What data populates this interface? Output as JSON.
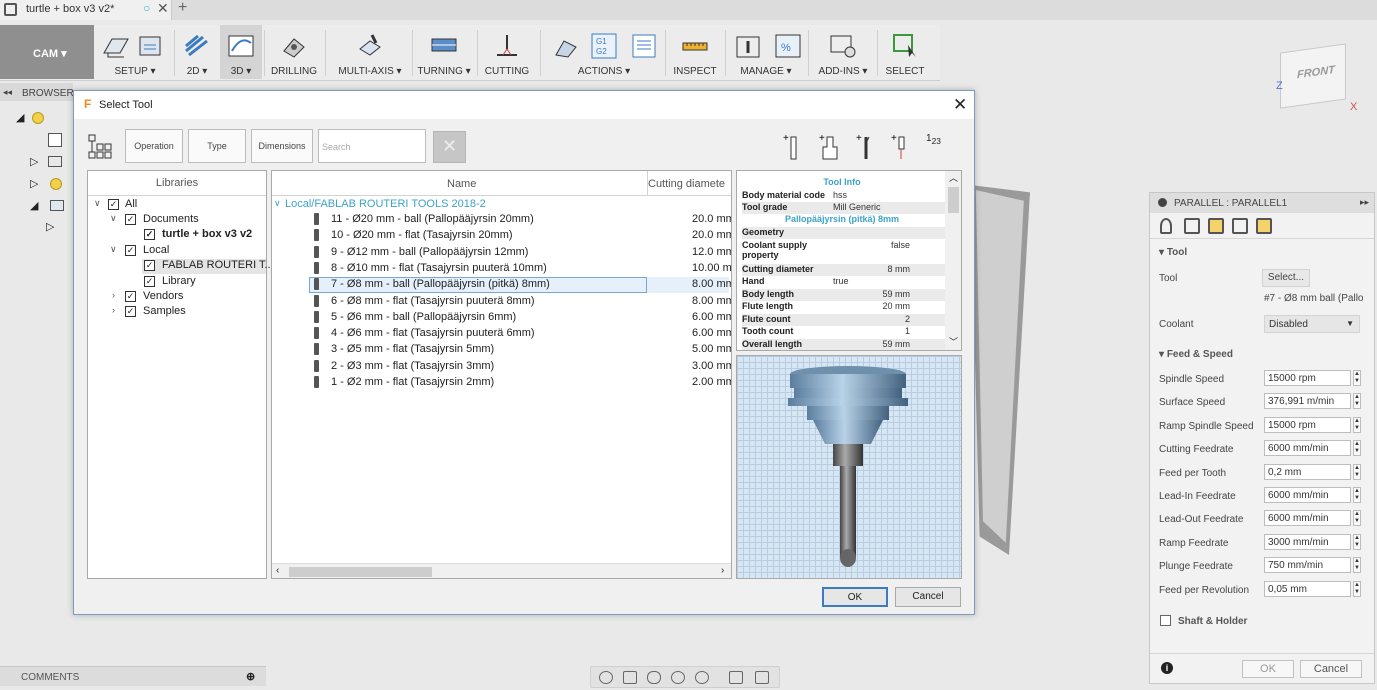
{
  "app": {
    "doc_tab": "turtle + box v3 v2*",
    "browser_label": "BROWSER",
    "comments_label": "COMMENTS"
  },
  "toolbar": {
    "workspace": "CAM ▾",
    "groups": [
      {
        "label": "SETUP ▾"
      },
      {
        "label": "2D ▾"
      },
      {
        "label": "3D ▾"
      },
      {
        "label": "DRILLING"
      },
      {
        "label": "MULTI-AXIS ▾"
      },
      {
        "label": "TURNING ▾"
      },
      {
        "label": "CUTTING"
      },
      {
        "label": "ACTIONS ▾"
      },
      {
        "label": "INSPECT"
      },
      {
        "label": "MANAGE ▾"
      },
      {
        "label": "ADD-INS ▾"
      },
      {
        "label": "SELECT"
      }
    ]
  },
  "viewcube": {
    "face": "FRONT",
    "axis_z": "Z",
    "axis_x": "X"
  },
  "dialog": {
    "title": "Select Tool",
    "filters": {
      "operation": "Operation",
      "type": "Type",
      "dimensions": "Dimensions",
      "search_placeholder": "Search"
    },
    "libraries": {
      "header": "Libraries",
      "items": [
        {
          "label": "All"
        },
        {
          "label": "Documents"
        },
        {
          "label": "turtle + box v3 v2"
        },
        {
          "label": "Local"
        },
        {
          "label": "FABLAB ROUTERI T..."
        },
        {
          "label": "Library"
        },
        {
          "label": "Vendors"
        },
        {
          "label": "Samples"
        }
      ]
    },
    "list": {
      "col_name": "Name",
      "col_diameter": "Cutting diamete",
      "path": "Local/FABLAB ROUTERI TOOLS 2018-2",
      "tools": [
        {
          "name": "11 - Ø20 mm - ball (Pallopääjyrsin 20mm)",
          "diameter": "20.0 mm"
        },
        {
          "name": "10 - Ø20 mm - flat (Tasajyrsin 20mm)",
          "diameter": "20.0 mm"
        },
        {
          "name": "9 - Ø12 mm - ball (Pallopääjyrsin 12mm)",
          "diameter": "12.0 mm"
        },
        {
          "name": "8 - Ø10 mm - flat (Tasajyrsin puuterä 10mm)",
          "diameter": "10.00 mm"
        },
        {
          "name": "7 - Ø8 mm - ball (Pallopääjyrsin (pitkä) 8mm)",
          "diameter": "8.00 mm"
        },
        {
          "name": "6 - Ø8 mm - flat (Tasajyrsin puuterä 8mm)",
          "diameter": "8.00 mm"
        },
        {
          "name": "5 - Ø6 mm - ball (Pallopääjyrsin 6mm)",
          "diameter": "6.00 mm"
        },
        {
          "name": "4 - Ø6 mm - flat (Tasajyrsin puuterä 6mm)",
          "diameter": "6.00 mm"
        },
        {
          "name": "3 - Ø5 mm - flat (Tasajyrsin 5mm)",
          "diameter": "5.00 mm"
        },
        {
          "name": "2 - Ø3 mm - flat (Tasajyrsin 3mm)",
          "diameter": "3.00 mm"
        },
        {
          "name": "1 - Ø2 mm - flat (Tasajyrsin 2mm)",
          "diameter": "2.00 mm"
        }
      ]
    },
    "info": {
      "title": "Tool Info",
      "body_material_label": "Body material code",
      "body_material": "hss",
      "tool_grade_label": "Tool grade",
      "tool_grade": "Mill Generic",
      "tool_name": "Pallopääjyrsin (pitkä) 8mm",
      "geometry": "Geometry",
      "coolant_label": "Coolant supply property",
      "coolant": "false",
      "cutting_diameter_label": "Cutting diameter",
      "cutting_diameter": "8 mm",
      "hand_label": "Hand",
      "hand": "true",
      "body_length_label": "Body length",
      "body_length": "59 mm",
      "flute_length_label": "Flute length",
      "flute_length": "20 mm",
      "flute_count_label": "Flute count",
      "flute_count": "2",
      "tooth_count_label": "Tooth count",
      "tooth_count": "1",
      "overall_length_label": "Overall length",
      "overall_length": "59 mm"
    },
    "ok": "OK",
    "cancel": "Cancel"
  },
  "panel": {
    "title": "PARALLEL : PARALLEL1",
    "tool_section": "Tool",
    "tool_label": "Tool",
    "tool_select": "Select...",
    "tool_current": "#7 - Ø8 mm ball (Pallo",
    "coolant_label": "Coolant",
    "coolant_value": "Disabled",
    "feed_section": "Feed & Speed",
    "rows": [
      {
        "label": "Spindle Speed",
        "value": "15000 rpm"
      },
      {
        "label": "Surface Speed",
        "value": "376,991 m/min"
      },
      {
        "label": "Ramp Spindle Speed",
        "value": "15000 rpm"
      },
      {
        "label": "Cutting Feedrate",
        "value": "6000 mm/min"
      },
      {
        "label": "Feed per Tooth",
        "value": "0,2 mm"
      },
      {
        "label": "Lead-In Feedrate",
        "value": "6000 mm/min"
      },
      {
        "label": "Lead-Out Feedrate",
        "value": "6000 mm/min"
      },
      {
        "label": "Ramp Feedrate",
        "value": "3000 mm/min"
      },
      {
        "label": "Plunge Feedrate",
        "value": "750 mm/min"
      },
      {
        "label": "Feed per Revolution",
        "value": "0,05 mm"
      }
    ],
    "shaft_holder": "Shaft & Holder",
    "ok": "OK",
    "cancel": "Cancel"
  }
}
